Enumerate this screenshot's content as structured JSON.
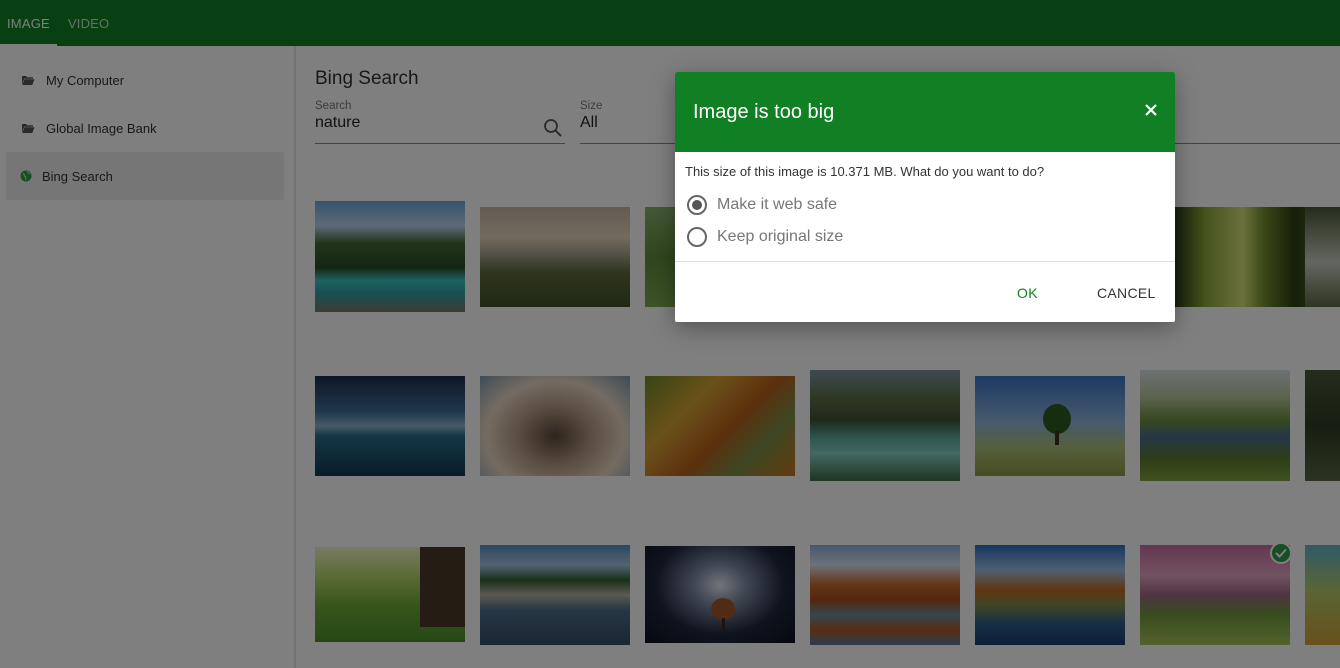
{
  "tabs": [
    {
      "label": "IMAGE",
      "active": true
    },
    {
      "label": "VIDEO",
      "active": false
    }
  ],
  "sidebar": {
    "items": [
      {
        "label": "My Computer",
        "icon": "folder-open-icon"
      },
      {
        "label": "Global Image Bank",
        "icon": "folder-open-icon"
      },
      {
        "label": "Bing Search",
        "icon": "globe-icon",
        "active": true
      }
    ]
  },
  "main": {
    "title": "Bing Search",
    "search": {
      "label": "Search",
      "value": "nature"
    },
    "size": {
      "label": "Size",
      "value": "All"
    }
  },
  "thumbnails": {
    "rows": [
      [
        "mountain river",
        "misty meadow sunrise",
        "green hills",
        "",
        "",
        "",
        "sunlit forest",
        "forest stream"
      ],
      [
        "blue ocean horizon",
        "howling wolves",
        "autumn lake dock",
        "mountain lake reflection",
        "lone tree field",
        "river with trees",
        "rocky forest"
      ],
      [
        "flower meadow tree",
        "tropical beach palms",
        "tree under star trails",
        "autumn lake forest",
        "autumn village lake",
        "cherry blossom park",
        "field"
      ]
    ],
    "selected": "cherry blossom park"
  },
  "dialog": {
    "title": "Image is too big",
    "message": "This size of this image is 10.371 MB. What do you want to do?",
    "options": [
      {
        "label": "Make it web safe",
        "selected": true
      },
      {
        "label": "Keep original size",
        "selected": false
      }
    ],
    "ok_label": "OK",
    "cancel_label": "CANCEL"
  },
  "colors": {
    "brand": "#118024",
    "overlay": "rgba(0,0,0,0.5)"
  }
}
